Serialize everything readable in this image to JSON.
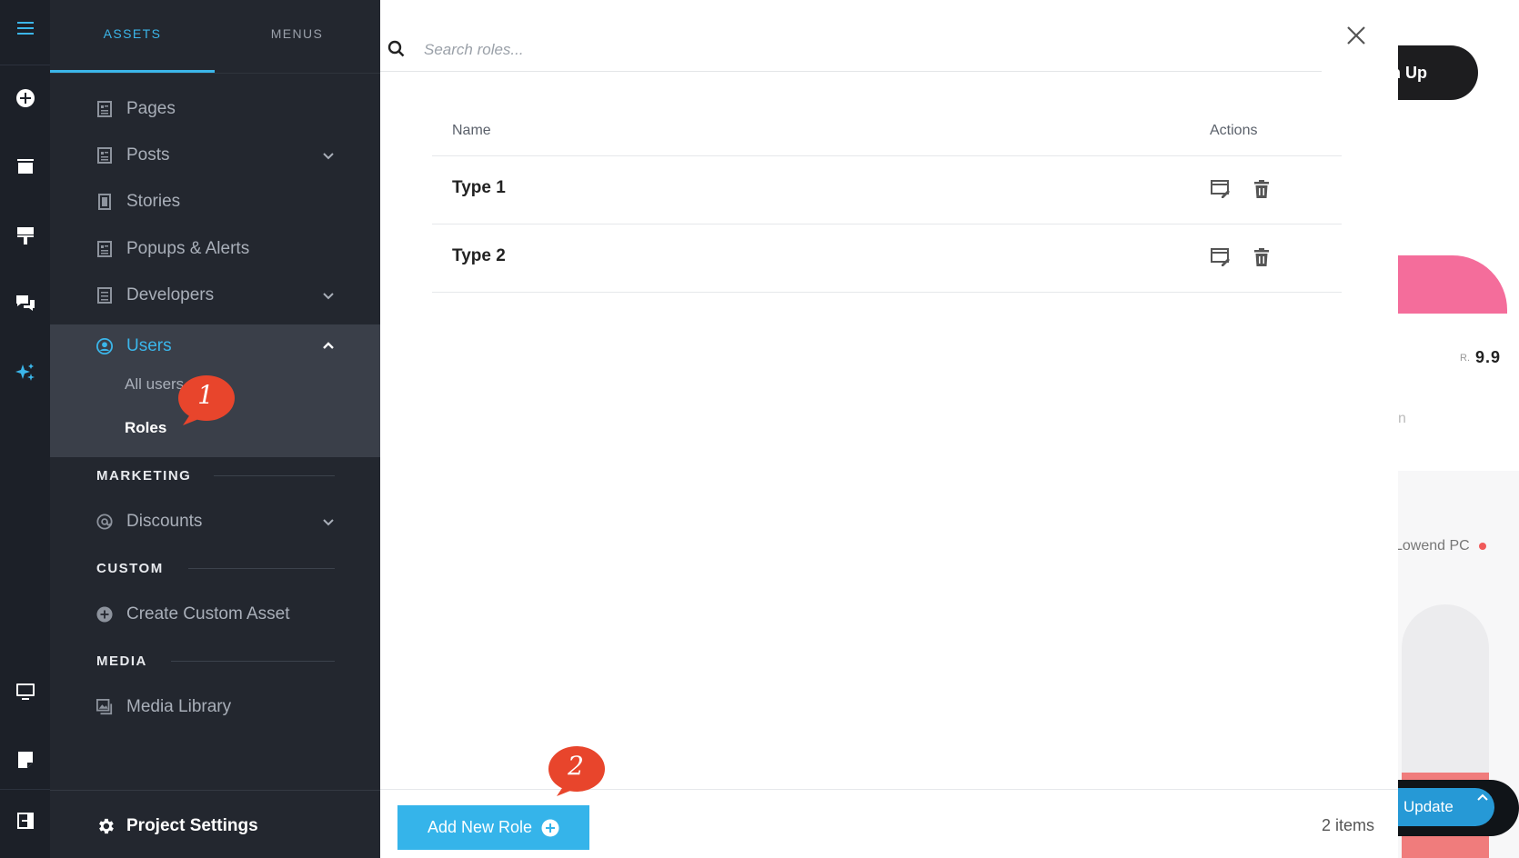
{
  "rail": {
    "icons": [
      "hamburger-menu-icon",
      "add-circle-icon",
      "window-icon",
      "paint-roller-icon",
      "chat-bubbles-icon",
      "sparkles-icon",
      "monitor-icon",
      "sticky-note-icon",
      "exit-icon"
    ]
  },
  "panel": {
    "tabs": [
      {
        "label": "ASSETS",
        "active": true
      },
      {
        "label": "MENUS",
        "active": false
      }
    ],
    "items": [
      {
        "label": "Pages",
        "icon": "document-icon",
        "has_chevron": false
      },
      {
        "label": "Posts",
        "icon": "document-icon",
        "has_chevron": true
      },
      {
        "label": "Stories",
        "icon": "phone-document-icon",
        "has_chevron": false
      },
      {
        "label": "Popups & Alerts",
        "icon": "document-icon",
        "has_chevron": false
      },
      {
        "label": "Developers",
        "icon": "document-icon",
        "has_chevron": true
      }
    ],
    "users": {
      "label": "Users",
      "icon": "user-circle-icon",
      "expanded": true,
      "sub_items": [
        {
          "label": "All users"
        },
        {
          "label": "Roles"
        }
      ]
    },
    "sections": {
      "marketing": {
        "title": "MARKETING",
        "items": [
          {
            "label": "Discounts",
            "icon": "at-sign-icon"
          }
        ]
      },
      "custom": {
        "title": "CUSTOM",
        "items": [
          {
            "label": "Create Custom Asset",
            "icon": "plus-circle-icon"
          }
        ]
      },
      "media": {
        "title": "MEDIA",
        "items": [
          {
            "label": "Media Library",
            "icon": "images-icon"
          }
        ]
      }
    },
    "settings_label": "Project Settings"
  },
  "annotations": [
    {
      "number": "1"
    },
    {
      "number": "2"
    }
  ],
  "modal": {
    "search_placeholder": "Search roles...",
    "columns": {
      "name": "Name",
      "actions": "Actions"
    },
    "rows": [
      {
        "name": "Type 1"
      },
      {
        "name": "Type 2"
      }
    ],
    "add_button_label": "Add New Role",
    "items_count": "2 items"
  },
  "background": {
    "signup_fragment": "n Up",
    "price_prefix": "R.",
    "price": "9.9",
    "fragment_n": "n",
    "product_fragment": "Lowend PC",
    "update_label": "Update"
  },
  "colors": {
    "accent": "#35b4ea",
    "sidebar": "#23272f",
    "rail": "#1c2028",
    "active_block": "#3a3f49",
    "bubble": "#e8452c"
  }
}
